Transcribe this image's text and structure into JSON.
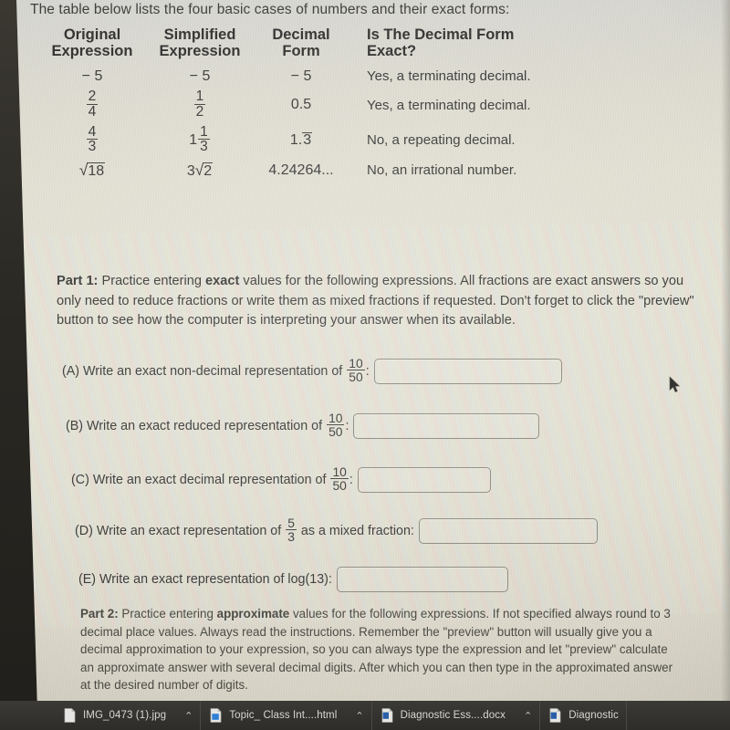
{
  "intro": "The table below lists the four basic cases of numbers and their exact forms:",
  "table": {
    "headers": {
      "col1_line1": "Original",
      "col1_line2": "Expression",
      "col2_line1": "Simplified",
      "col2_line2": "Expression",
      "col3_line1": "Decimal",
      "col3_line2": "Form",
      "col4": "Is The Decimal Form Exact?"
    },
    "rows": [
      {
        "original": "− 5",
        "simplified": "− 5",
        "decimal": "− 5",
        "exact": "Yes, a terminating decimal."
      },
      {
        "original_num": "2",
        "original_den": "4",
        "simplified_num": "1",
        "simplified_den": "2",
        "decimal": "0.5",
        "exact": "Yes, a terminating decimal."
      },
      {
        "original_num": "4",
        "original_den": "3",
        "simplified_whole": "1",
        "simplified_num": "1",
        "simplified_den": "3",
        "decimal_int": "1.",
        "decimal_repeat": "3",
        "exact": "No, a repeating decimal."
      },
      {
        "original_radicand": "18",
        "simplified_coef": "3",
        "simplified_radicand": "2",
        "decimal": "4.24264...",
        "exact": "No, an irrational number."
      }
    ]
  },
  "part1": {
    "label": "Part 1:",
    "text_before": " Practice entering ",
    "bold": "exact",
    "text_after": " values for the following expressions. All fractions are exact answers so you only need to reduce fractions or write them as mixed fractions if requested. Don't forget to click the \"preview\" button to see how the computer is interpreting your answer when its available."
  },
  "questions": [
    {
      "id": "A",
      "tag": "(A)",
      "text": "Write an exact non-decimal representation of",
      "frac_num": "10",
      "frac_den": "50",
      "colon": ":",
      "suffix": "",
      "value": "",
      "placeholder": ""
    },
    {
      "id": "B",
      "tag": "(B)",
      "text": "Write an exact reduced representation of",
      "frac_num": "10",
      "frac_den": "50",
      "colon": ":",
      "suffix": "",
      "value": "",
      "placeholder": ""
    },
    {
      "id": "C",
      "tag": "(C)",
      "text": "Write an exact decimal representation of",
      "frac_num": "10",
      "frac_den": "50",
      "colon": ":",
      "suffix": "",
      "value": "",
      "placeholder": ""
    },
    {
      "id": "D",
      "tag": "(D)",
      "text": "Write an exact representation of",
      "frac_num": "5",
      "frac_den": "3",
      "colon": "",
      "suffix": "as a mixed fraction:",
      "value": "",
      "placeholder": ""
    },
    {
      "id": "E",
      "tag": "(E)",
      "text": "Write an exact representation of",
      "expr": "log(13):",
      "value": "",
      "placeholder": ""
    }
  ],
  "part2": {
    "label": "Part 2:",
    "text_before": " Practice entering ",
    "bold": "approximate",
    "text_after": " values for the following expressions. If not specified always round to 3 decimal place values. Always read the instructions. Remember the \"preview\" button will usually give you a decimal approximation to your expression, so you can always type the expression and let \"preview\" calculate an approximate answer with several decimal digits. After which you can then type in the approximated answer at the desired number of digits."
  },
  "taskbar": {
    "items": [
      {
        "icon": "image-file-icon",
        "label": "IMG_0473 (1).jpg",
        "caret": "⌃"
      },
      {
        "icon": "html-file-icon",
        "label": "Topic_ Class Int....html",
        "caret": "⌃"
      },
      {
        "icon": "word-file-icon",
        "label": "Diagnostic Ess....docx",
        "caret": "⌃"
      },
      {
        "icon": "word-file-icon",
        "label": "Diagnostic",
        "caret": ""
      }
    ]
  },
  "colors": {
    "page_bg": "#e2e0d2",
    "text": "#3b3b39",
    "field_border": "#8d8b80",
    "taskbar_bg": "#343330",
    "taskbar_text": "#d8d7d2"
  }
}
